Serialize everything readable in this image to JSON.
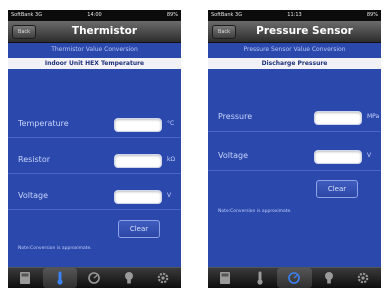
{
  "left": {
    "status": {
      "carrier": "SoftBank 3G",
      "time": "14:00",
      "battery": "89%"
    },
    "back_label": "Back",
    "title": "Thermistor",
    "subtitle": "Thermistor Value Conversion",
    "section": "Indoor Unit HEX Temperature",
    "rows": [
      {
        "label": "Temperature",
        "value": "",
        "unit": "°C"
      },
      {
        "label": "Resistor",
        "value": "",
        "unit": "kΩ"
      },
      {
        "label": "Voltage",
        "value": "",
        "unit": "V"
      }
    ],
    "clear_label": "Clear",
    "note": "Note:Conversion is approximate.",
    "active_tab": "thermometer"
  },
  "right": {
    "status": {
      "carrier": "SoftBank 3G",
      "time": "11:13",
      "battery": "89%"
    },
    "back_label": "Back",
    "title": "Pressure Sensor",
    "subtitle": "Pressure Sensor Value Conversion",
    "section": "Discharge Pressure",
    "rows": [
      {
        "label": "Pressure",
        "value": "",
        "unit": "MPa"
      },
      {
        "label": "Voltage",
        "value": "",
        "unit": "V"
      }
    ],
    "clear_label": "Clear",
    "note": "Note:Conversion is approximate.",
    "active_tab": "gauge"
  },
  "tabs": [
    "calculator-icon",
    "thermometer-icon",
    "gauge-icon",
    "lightbulb-icon",
    "gear-icon"
  ],
  "colors": {
    "screen_bg": "#2b48ad",
    "band_bg": "#f2f2f6",
    "band_text": "#1d2f7c",
    "active_tab_icon": "#3b82f6"
  }
}
